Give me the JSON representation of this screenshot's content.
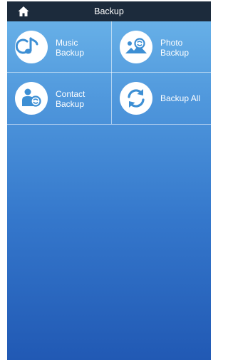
{
  "header": {
    "title": "Backup",
    "home_icon": "home-icon"
  },
  "tiles": [
    {
      "line1": "Music",
      "line2": "Backup",
      "icon": "music-note-icon"
    },
    {
      "line1": "Photo",
      "line2": "Backup",
      "icon": "photo-landscape-icon"
    },
    {
      "line1": "Contact",
      "line2": "Backup",
      "icon": "contact-person-icon"
    },
    {
      "line1": "Backup All",
      "icon": "sync-arrows-icon"
    }
  ],
  "colors": {
    "header_bg": "#1c2b3c",
    "gradient_top": "#6db6ea",
    "gradient_bottom": "#2159b4",
    "icon_blue": "#3d8fd4"
  }
}
